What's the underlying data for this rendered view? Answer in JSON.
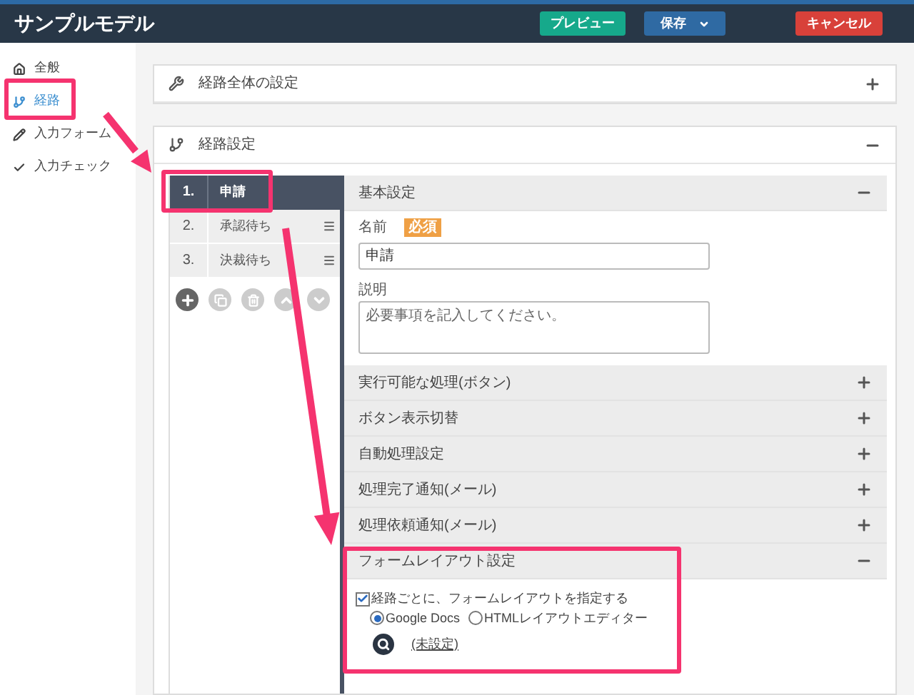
{
  "header": {
    "title": "サンプルモデル",
    "buttons": [
      {
        "kind": "preview",
        "label": "プレビュー"
      },
      {
        "kind": "save",
        "label": "保存"
      },
      {
        "kind": "cancel",
        "label": "キャンセル"
      }
    ]
  },
  "sidebar": {
    "items": [
      {
        "kind": "home",
        "label": "全般",
        "selected": false
      },
      {
        "kind": "route",
        "label": "経路",
        "selected": true
      },
      {
        "kind": "form",
        "label": "入力フォーム",
        "selected": false
      },
      {
        "kind": "check",
        "label": "入力チェック",
        "selected": false
      }
    ]
  },
  "panels": [
    {
      "kind": "wrench",
      "title": "経路全体の設定",
      "expanded": false
    },
    {
      "kind": "route",
      "title": "経路設定",
      "expanded": true
    }
  ],
  "steps": [
    {
      "number": "1.",
      "name": "申請",
      "selected": true
    },
    {
      "number": "2.",
      "name": "承認待ち",
      "selected": false
    },
    {
      "number": "3.",
      "name": "決裁待ち",
      "selected": false
    }
  ],
  "sections": [
    {
      "kind": "basic",
      "title": "基本設定",
      "expanded": true
    },
    {
      "title": "実行可能な処理(ボタン)",
      "expanded": false
    },
    {
      "title": "ボタン表示切替",
      "expanded": false
    },
    {
      "title": "自動処理設定",
      "expanded": false
    },
    {
      "title": "処理完了通知(メール)",
      "expanded": false
    },
    {
      "title": "処理依頼通知(メール)",
      "expanded": false
    },
    {
      "kind": "layout",
      "title": "フォームレイアウト設定",
      "expanded": true
    }
  ],
  "basic": {
    "name_label": "名前",
    "required_badge": "必須",
    "name_value": "申請",
    "description_label": "説明",
    "description_placeholder": "必要事項を記入してください。"
  },
  "layout": {
    "checkbox": {
      "label": "経路ごとに、フォームレイアウトを指定する",
      "checked": true
    },
    "radios": [
      {
        "label": "Google Docs",
        "selected": true
      },
      {
        "label": "HTMLレイアウトエディター",
        "selected": false
      }
    ],
    "link": "(未設定)"
  }
}
